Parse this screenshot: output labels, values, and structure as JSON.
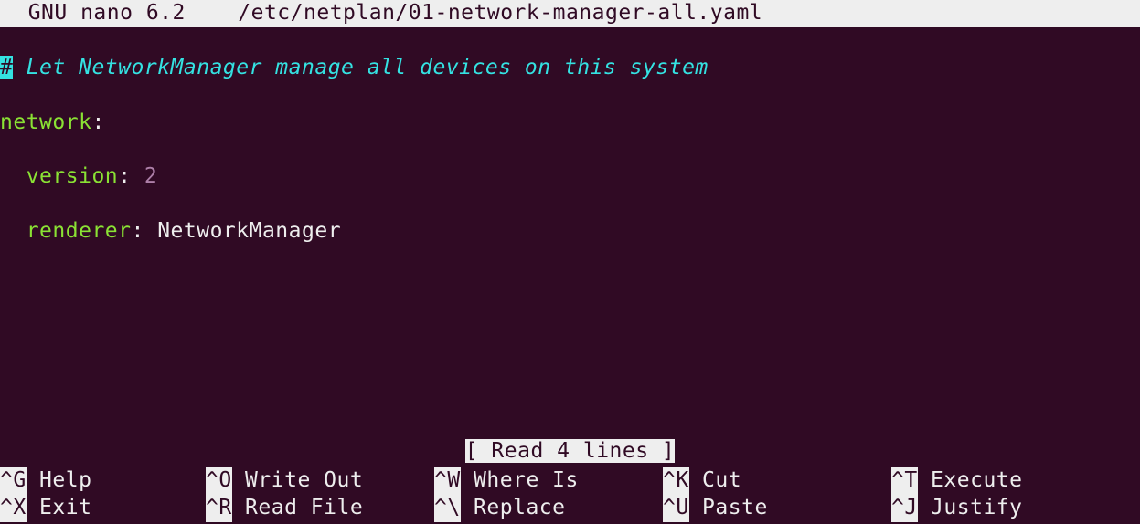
{
  "title_bar": {
    "app": "  GNU nano 6.2",
    "file": "/etc/netplan/01-network-manager-all.yaml"
  },
  "content": {
    "comment_hash": "#",
    "comment_text": " Let NetworkManager manage all devices on this system",
    "line2_key": "network",
    "line2_colon": ":",
    "line3_indent": "  ",
    "line3_key": "version",
    "line3_colon": ": ",
    "line3_val": "2",
    "line4_indent": "  ",
    "line4_key": "renderer",
    "line4_colon": ": ",
    "line4_val": "NetworkManager"
  },
  "status_message": "[ Read 4 lines ]",
  "shortcuts": {
    "row1": [
      {
        "key": "^G",
        "label": " Help"
      },
      {
        "key": "^O",
        "label": " Write Out"
      },
      {
        "key": "^W",
        "label": " Where Is"
      },
      {
        "key": "^K",
        "label": " Cut"
      },
      {
        "key": "^T",
        "label": " Execute"
      }
    ],
    "row2": [
      {
        "key": "^X",
        "label": " Exit"
      },
      {
        "key": "^R",
        "label": " Read File"
      },
      {
        "key": "^\\",
        "label": " Replace"
      },
      {
        "key": "^U",
        "label": " Paste"
      },
      {
        "key": "^J",
        "label": " Justify"
      }
    ]
  }
}
